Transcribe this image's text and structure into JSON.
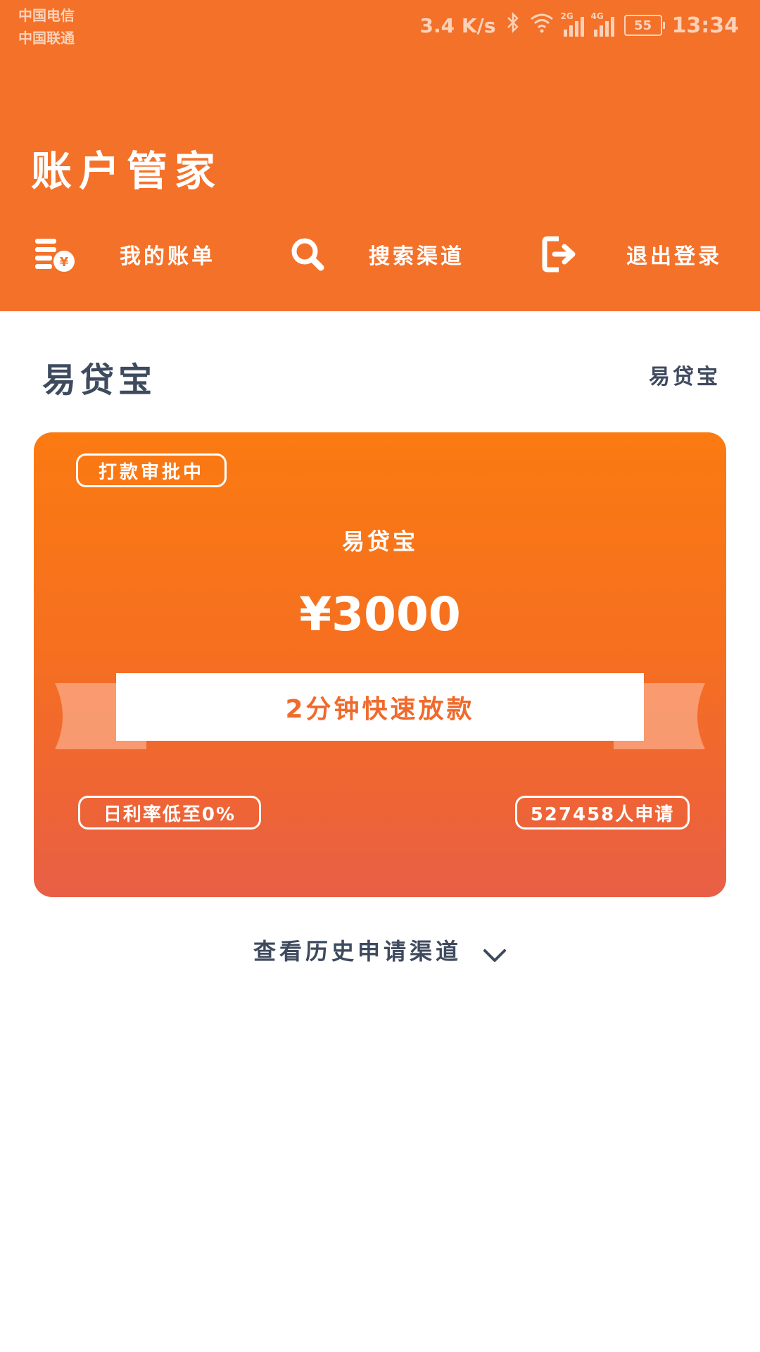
{
  "status_bar": {
    "carrier_1": "中国电信",
    "carrier_2": "中国联通",
    "net_speed": "3.4 K/s",
    "signal_1": "2G",
    "signal_2": "4G",
    "battery": "55",
    "time": "13:34"
  },
  "header": {
    "title": "账户管家",
    "nav": [
      {
        "label": "我的账单",
        "icon": "bill-icon"
      },
      {
        "label": "搜索渠道",
        "icon": "search-icon"
      },
      {
        "label": "退出登录",
        "icon": "logout-icon"
      }
    ]
  },
  "section": {
    "title": "易贷宝",
    "right_label": "易贷宝"
  },
  "card": {
    "status": "打款审批中",
    "name": "易贷宝",
    "amount": "¥3000",
    "banner": "2分钟快速放款",
    "rate": "日利率低至0%",
    "applicants": "527458人申请"
  },
  "history": {
    "label": "查看历史申请渠道",
    "icon": "chevron-down-icon"
  },
  "colors": {
    "header_bg": "#f4712a",
    "card_top": "#fb7a12",
    "card_bottom": "#e85f46",
    "dark_text": "#3e4a5e"
  }
}
